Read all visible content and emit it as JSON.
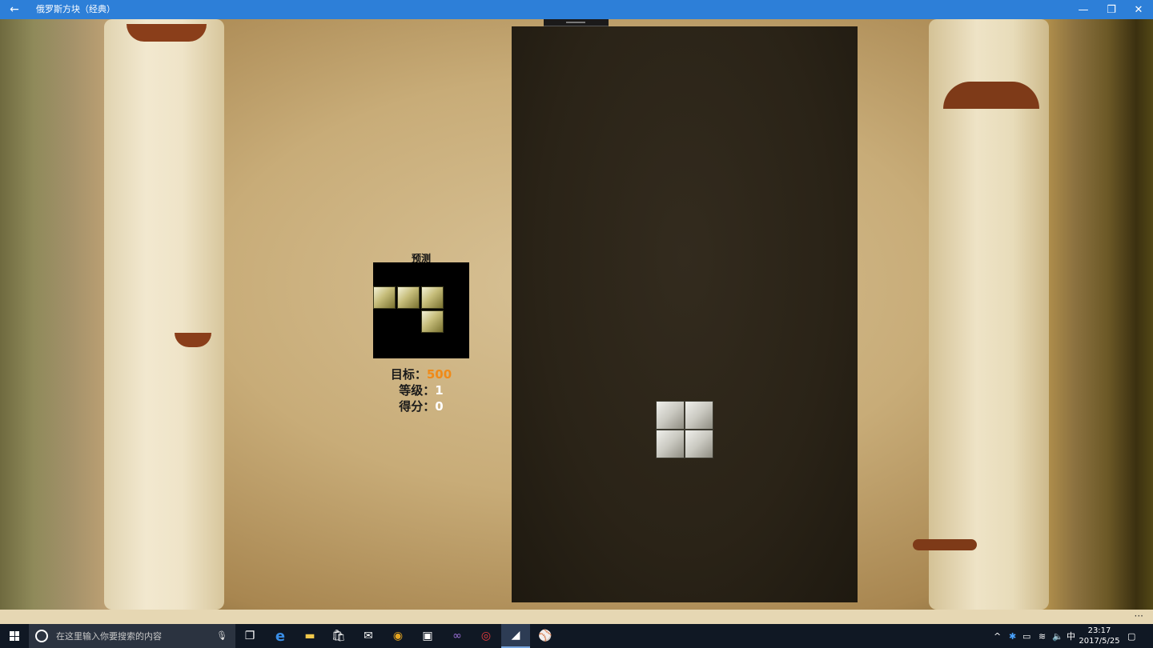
{
  "window": {
    "title": "俄罗斯方块（经典）",
    "back_icon": "arrow-left-icon",
    "minimize_glyph": "—",
    "restore_glyph": "❐",
    "close_glyph": "✕"
  },
  "game": {
    "preview_label": "预测",
    "preview_piece": {
      "type": "J",
      "color": "#c6bd7a"
    },
    "stats": {
      "target_label": "目标：",
      "target_value": "500",
      "level_label": "等级：",
      "level_value": "1",
      "score_label": "得分：",
      "score_value": "0"
    },
    "current_piece": {
      "type": "O",
      "color": "#d9d9d4"
    }
  },
  "appbar": {
    "more_glyph": "···"
  },
  "taskbar": {
    "search_placeholder": "在这里输入你要搜索的内容",
    "apps": [
      {
        "name": "task-view-icon",
        "glyph": "❐"
      },
      {
        "name": "edge-icon",
        "glyph": "e",
        "color": "#3a8ee6"
      },
      {
        "name": "file-explorer-icon",
        "glyph": "▬",
        "color": "#f2c94c"
      },
      {
        "name": "store-icon",
        "glyph": "🛍"
      },
      {
        "name": "mail-icon",
        "glyph": "✉"
      },
      {
        "name": "chrome-icon",
        "glyph": "◉",
        "color": "#e5a521"
      },
      {
        "name": "remote-desktop-icon",
        "glyph": "▣"
      },
      {
        "name": "visual-studio-icon",
        "glyph": "∞",
        "color": "#9b6fd6"
      },
      {
        "name": "netease-music-icon",
        "glyph": "◎",
        "color": "#e83c3c"
      },
      {
        "name": "tetris-app-icon",
        "glyph": "◢"
      },
      {
        "name": "baseball-app-icon",
        "glyph": "⚾"
      }
    ],
    "tray": {
      "chevron_glyph": "^",
      "ime": "中",
      "time": "23:17",
      "date": "2017/5/25"
    }
  }
}
